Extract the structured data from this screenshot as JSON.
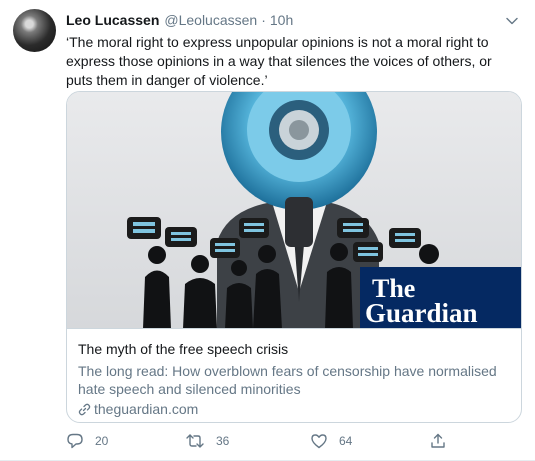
{
  "tweet": {
    "author_name": "Leo Lucassen",
    "author_handle": "@Leolucassen",
    "separator": "·",
    "time": "10h",
    "text": "‘The moral right to express unpopular opinions is not a moral right to express those opinions in a way that silences the voices of others, or puts them in danger of violence.’"
  },
  "card": {
    "logo_line1": "The",
    "logo_line2": "Guardian",
    "logo_color": "#052962",
    "title": "The myth of the free speech crisis",
    "description": "The long read: How overblown fears of censorship have normalised hate speech and silenced minorities",
    "domain": "theguardian.com"
  },
  "actions": {
    "reply_icon": "reply-icon",
    "reply_count": "20",
    "retweet_icon": "retweet-icon",
    "retweet_count": "36",
    "like_icon": "heart-icon",
    "like_count": "64",
    "share_icon": "share-icon"
  },
  "colors": {
    "text_primary": "#14171a",
    "text_secondary": "#657786",
    "border": "#ccd6dd"
  }
}
